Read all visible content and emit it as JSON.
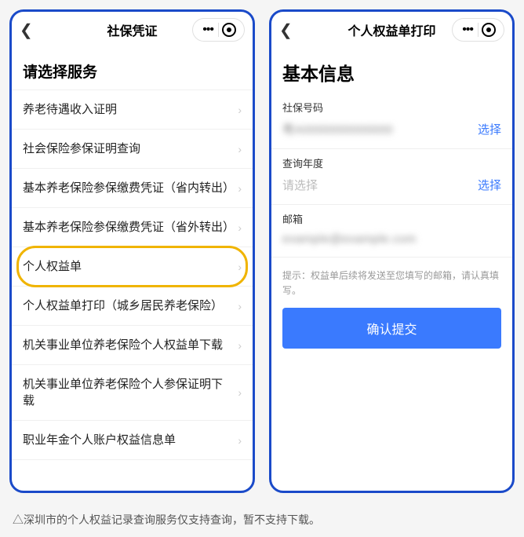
{
  "left": {
    "title": "社保凭证",
    "section_title": "请选择服务",
    "items": [
      "养老待遇收入证明",
      "社会保险参保证明查询",
      "基本养老保险参保缴费凭证（省内转出）",
      "基本养老保险参保缴费凭证（省外转出）",
      "个人权益单",
      "个人权益单打印（城乡居民养老保险）",
      "机关事业单位养老保险个人权益单下载",
      "机关事业单位养老保险个人参保证明下载",
      "职业年金个人账户权益信息单"
    ],
    "highlight_index": 4
  },
  "right": {
    "title": "个人权益单打印",
    "section_title": "基本信息",
    "fields": {
      "sbh_label": "社保号码",
      "sbh_value": "粤A0000000000000",
      "year_label": "查询年度",
      "year_placeholder": "请选择",
      "email_label": "邮箱",
      "email_value": "example@example.com",
      "select_action": "选择"
    },
    "hint": "提示：权益单后续将发送至您填写的邮箱，请认真填写。",
    "submit": "确认提交"
  },
  "footnote": "△深圳市的个人权益记录查询服务仅支持查询，暂不支持下载。"
}
